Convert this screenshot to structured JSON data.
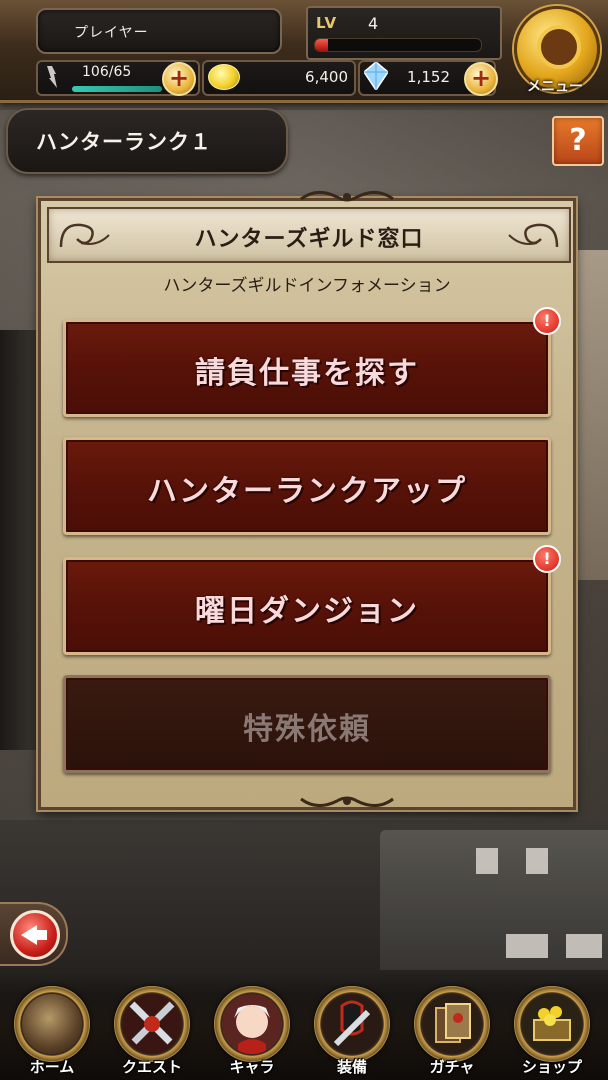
{
  "header": {
    "player_name": "プレイヤー",
    "level_label": "LV",
    "level_value": "4",
    "level_progress": 0.08,
    "stamina_text": "106/65",
    "stamina_fill": 1.0,
    "coins": "6,400",
    "gems": "1,152",
    "menu_label": "メニュー"
  },
  "rank": {
    "label": "ハンターランク１",
    "help_label": "?"
  },
  "panel": {
    "title": "ハンターズギルド窓口",
    "subtitle": "ハンターズギルドインフォメーション",
    "items": [
      {
        "label": "請負仕事を探す",
        "alert": "!"
      },
      {
        "label": "ハンターランクアップ"
      },
      {
        "label": "曜日ダンジョン",
        "alert": "!"
      },
      {
        "label": "特殊依頼"
      }
    ]
  },
  "nav": {
    "items": [
      {
        "label": "ホーム",
        "icon": "home-icon"
      },
      {
        "label": "クエスト",
        "icon": "swords-icon"
      },
      {
        "label": "キャラ",
        "icon": "character-icon"
      },
      {
        "label": "装備",
        "icon": "equipment-icon"
      },
      {
        "label": "ガチャ",
        "icon": "gacha-icon"
      },
      {
        "label": "ショップ",
        "icon": "shop-icon"
      }
    ]
  },
  "colors": {
    "accent_gold": "#e3a51b",
    "button_red": "#571208",
    "panel_parchment": "#c5b48d",
    "exp_red": "#d21a10",
    "stamina_teal": "#37c9b2"
  }
}
